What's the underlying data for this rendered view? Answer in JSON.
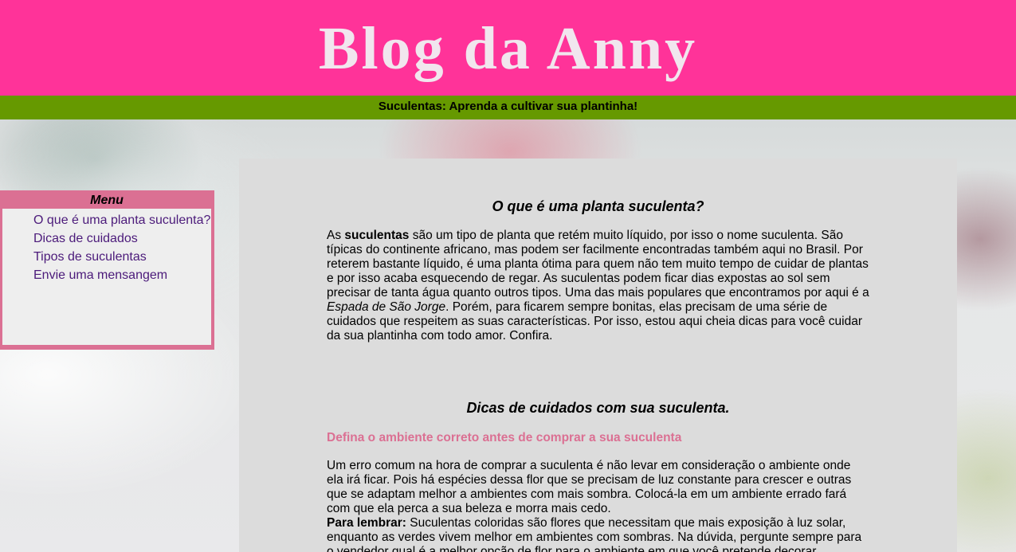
{
  "header": {
    "title": "Blog da Anny",
    "subtitle": "Suculentas: Aprenda a cultivar sua plantinha!"
  },
  "menu": {
    "title": "Menu",
    "items": [
      "O que é uma planta suculenta?",
      "Dicas de cuidados",
      "Tipos de suculentas",
      "Envie uma mensangem"
    ]
  },
  "section1": {
    "heading": "O que é uma planta suculenta?",
    "p_start": "As ",
    "p_bold": "suculentas",
    "p_mid": " são um tipo de planta que retém muito líquido, por isso o nome suculenta. São típicas do continente africano, mas podem ser facilmente encontradas também aqui no Brasil. Por reterem bastante líquido, é uma planta ótima para quem não tem muito tempo de cuidar de plantas e por isso acaba esquecendo de regar. As suculentas podem ficar dias expostas ao sol sem precisar de tanta água quanto outros tipos. Uma das mais populares que encontramos por aqui é a ",
    "p_italic": "Espada de São Jorge",
    "p_end": ". Porém, para ficarem sempre bonitas, elas precisam de uma série de cuidados que respeitem as suas características. Por isso, estou aqui cheia dicas para você cuidar da sua plantinha com todo amor. Confira."
  },
  "section2": {
    "heading": "Dicas de cuidados com sua suculenta.",
    "subheading": "Defina o ambiente correto antes de comprar a sua suculenta",
    "p1": "Um erro comum na hora de comprar a suculenta é não levar em consideração o ambiente onde ela irá ficar. Pois há espécies dessa flor que se precisam de luz constante para crescer e outras que se adaptam melhor a ambientes com mais sombra. Colocá-la em um ambiente errado fará com que ela perca a sua beleza e morra mais cedo.",
    "p2_bold": "Para lembrar:",
    "p2_text": " Suculentas coloridas são flores que necessitam que mais exposição à luz solar, enquanto as verdes vivem melhor em ambientes com sombras. Na dúvida, pergunte sempre para o vendedor qual é a melhor opção de flor para o ambiente em que você pretende decorar."
  },
  "colors": {
    "header_bg": "#ff3399",
    "subtitle_bg": "#669900",
    "menu_border": "#db7093",
    "link": "#4b1a7a",
    "content_bg": "#dcdcdc"
  }
}
